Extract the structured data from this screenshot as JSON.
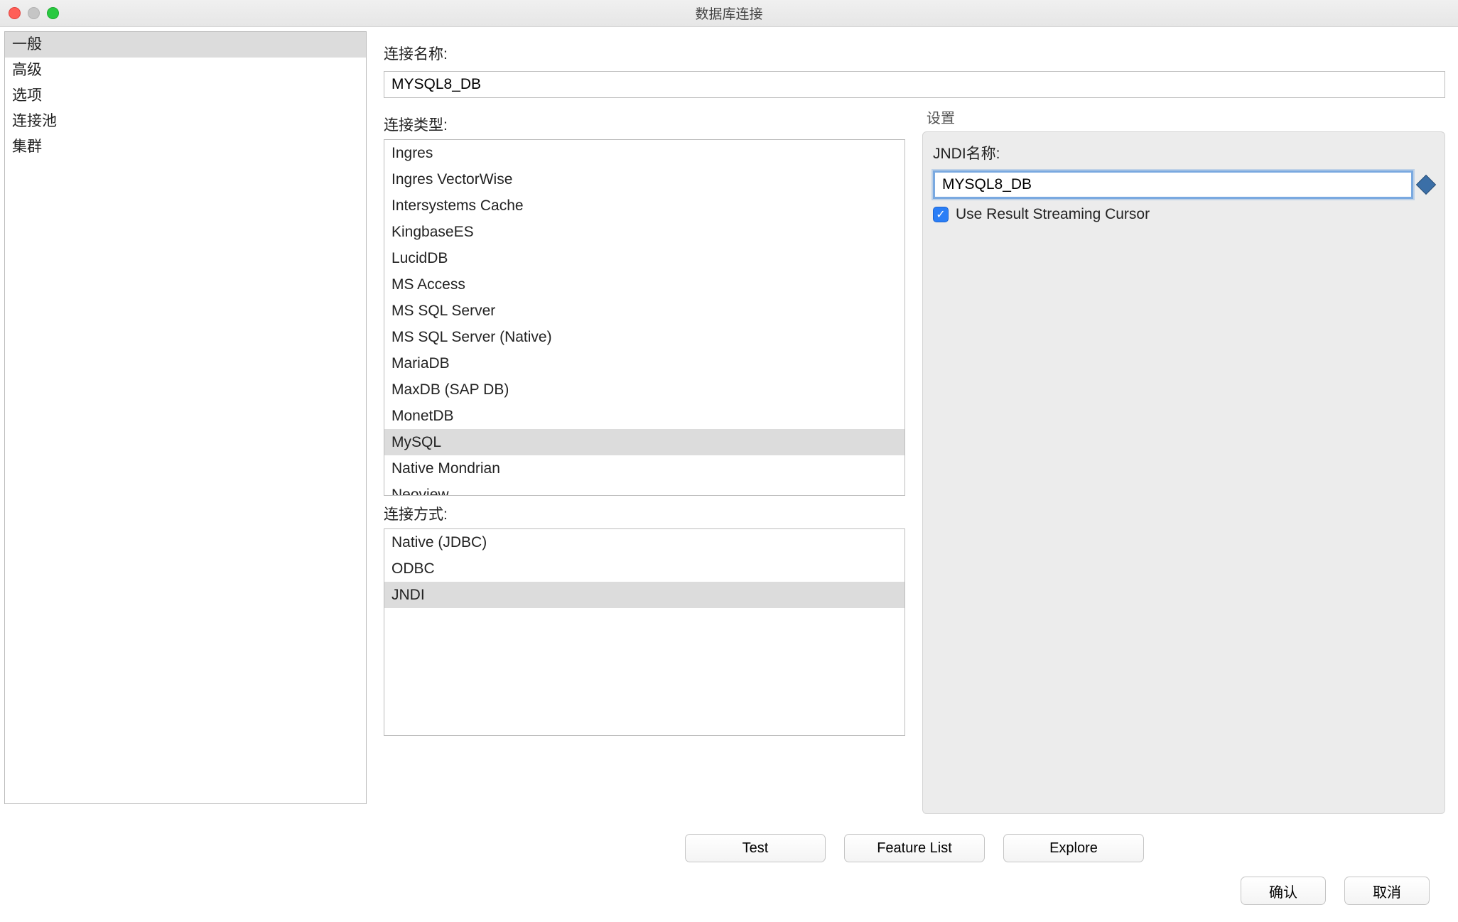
{
  "window": {
    "title": "数据库连接"
  },
  "sidebar": {
    "items": [
      {
        "label": "一般",
        "selected": true
      },
      {
        "label": "高级",
        "selected": false
      },
      {
        "label": "选项",
        "selected": false
      },
      {
        "label": "连接池",
        "selected": false
      },
      {
        "label": "集群",
        "selected": false
      }
    ]
  },
  "form": {
    "connection_name_label": "连接名称:",
    "connection_name_value": "MYSQL8_DB",
    "connection_type_label": "连接类型:",
    "connection_method_label": "连接方式:",
    "types": [
      "Ingres",
      "Ingres VectorWise",
      "Intersystems Cache",
      "KingbaseES",
      "LucidDB",
      "MS Access",
      "MS SQL Server",
      "MS SQL Server (Native)",
      "MariaDB",
      "MaxDB (SAP DB)",
      "MonetDB",
      "MySQL",
      "Native Mondrian",
      "Neoview"
    ],
    "type_selected": "MySQL",
    "methods": [
      "Native (JDBC)",
      "ODBC",
      "JNDI"
    ],
    "method_selected": "JNDI"
  },
  "settings": {
    "group_label": "设置",
    "jndi_label": "JNDI名称:",
    "jndi_value": "MYSQL8_DB",
    "checkbox_label": "Use Result Streaming Cursor",
    "checkbox_checked": true
  },
  "buttons": {
    "test": "Test",
    "feature_list": "Feature List",
    "explore": "Explore",
    "ok": "确认",
    "cancel": "取消"
  }
}
